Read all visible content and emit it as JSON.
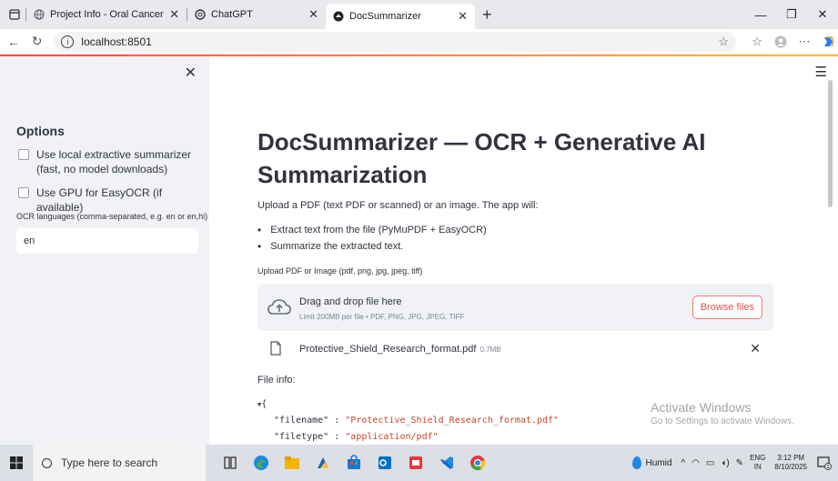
{
  "browser": {
    "tabs": [
      {
        "label": "Project Info - Oral Cancer Detecti",
        "active": false
      },
      {
        "label": "ChatGPT",
        "active": false
      },
      {
        "label": "DocSummarizer",
        "active": true
      }
    ],
    "url": "localhost:8501",
    "accent": "#ff4b4b"
  },
  "sidebar": {
    "heading": "Options",
    "options": [
      {
        "label": "Use local extractive summarizer (fast, no model downloads)",
        "checked": false
      },
      {
        "label": "Use GPU for EasyOCR (if available)",
        "checked": false
      }
    ],
    "ocr_label": "OCR languages (comma-separated, e.g. en or en,hi)",
    "ocr_value": "en"
  },
  "main": {
    "title": "DocSummarizer — OCR + Generative AI Summarization",
    "intro": "Upload a PDF (text PDF or scanned) or an image. The app will:",
    "bullets": [
      "Extract text from the file (PyMuPDF + EasyOCR)",
      "Summarize the extracted text."
    ],
    "upload_label": "Upload PDF or Image (pdf, png, jpg, jpeg, tiff)",
    "dropzone": {
      "title": "Drag and drop file here",
      "subtitle": "Limit 200MB per file • PDF, PNG, JPG, JPEG, TIFF",
      "browse": "Browse files"
    },
    "file": {
      "name": "Protective_Shield_Research_format.pdf",
      "size": "0.7MB"
    },
    "file_info_label": "File info:",
    "json_view": {
      "open_brace": "{",
      "rows": [
        {
          "key": "\"filename\"",
          "sep": " : ",
          "value": "\"Protective_Shield_Research_format.pdf\""
        },
        {
          "key": "\"filetype\"",
          "sep": " : ",
          "value": "\"application/pdf\""
        }
      ]
    }
  },
  "watermark": {
    "line1": "Activate Windows",
    "line2": "Go to Settings to activate Windows."
  },
  "taskbar": {
    "search_placeholder": "Type here to search",
    "weather": "Humid",
    "lang_line1": "ENG",
    "lang_line2": "IN",
    "time": "3:12 PM",
    "date": "8/10/2025",
    "notification_count": "1"
  }
}
